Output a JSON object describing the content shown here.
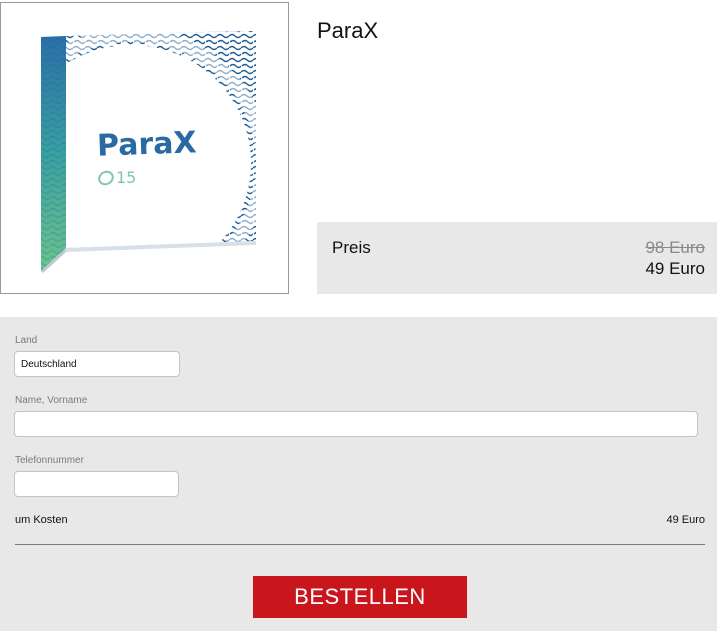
{
  "product": {
    "name": "ParaX",
    "box_brand": "ParaX",
    "box_count": "15"
  },
  "price": {
    "label": "Preis",
    "old": "98 Euro",
    "new": "49 Euro"
  },
  "form": {
    "country_label": "Land",
    "country_value": "Deutschland",
    "name_label": "Name, Vorname",
    "name_value": "",
    "phone_label": "Telefonnummer",
    "phone_value": "",
    "total_label": "um Kosten",
    "total_value": "49 Euro",
    "order_button": "BESTELLEN"
  },
  "colors": {
    "order_button": "#c9161c",
    "panel_background": "#e8e8e8",
    "box_blue": "#1f6ea8",
    "box_green": "#4cae8f"
  }
}
